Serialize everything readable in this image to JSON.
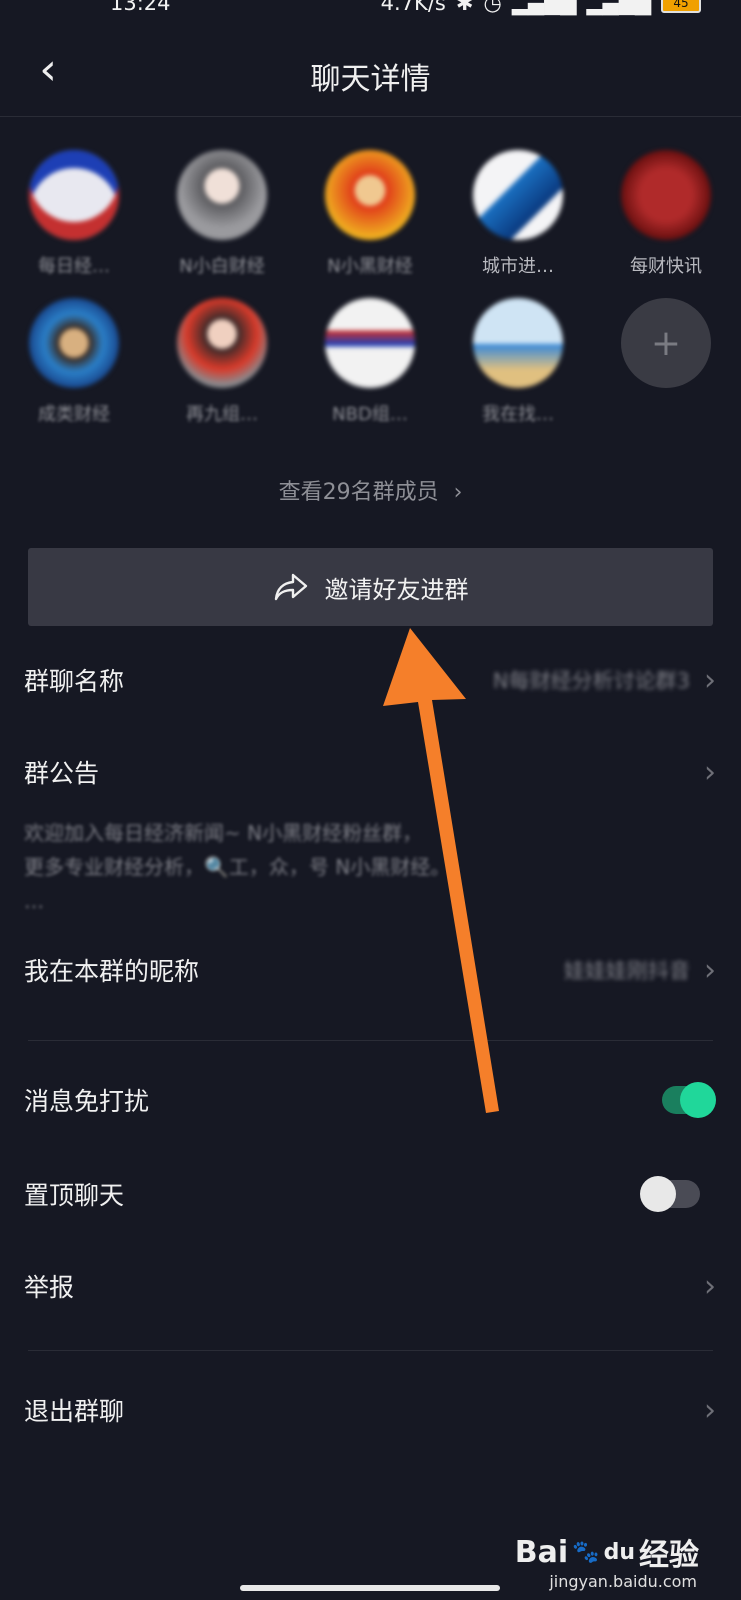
{
  "status": {
    "time": "13:24",
    "speed": "4.7K/s",
    "battery": "45"
  },
  "header": {
    "title": "聊天详情",
    "back_icon": "‹"
  },
  "members": [
    {
      "name": "每日经…",
      "color": "#e8e8f0"
    },
    {
      "name": "N小白财经",
      "color": "#8c8c90"
    },
    {
      "name": "N小黑财经",
      "color": "#e84a1a"
    },
    {
      "name": "城市进…",
      "color": "#f0f0f4"
    },
    {
      "name": "每财快讯",
      "color": "#8a1a1a"
    },
    {
      "name": "成类财经",
      "color": "#2a7fc8"
    },
    {
      "name": "再九组…",
      "color": "#7a7a7e"
    },
    {
      "name": "NBD组…",
      "color": "#f2f2f2"
    },
    {
      "name": "我在找…",
      "color": "#9cc8e8"
    },
    {
      "name": "",
      "add_symbol": "+"
    }
  ],
  "view_members": "查看29名群成员",
  "invite": {
    "label": "邀请好友进群",
    "icon": "share-arrow-icon"
  },
  "group_name": {
    "label": "群聊名称",
    "value": "N每财经分析讨论群3"
  },
  "notice": {
    "label": "群公告",
    "line1": "欢迎加入每日经济新闻~ N小黑财经粉丝群，",
    "line2": "更多专业财经分析，🔍工，众，号 N小黑财经。",
    "line3": "…"
  },
  "nickname": {
    "label": "我在本群的昵称",
    "value": "娃娃娃刚抖音"
  },
  "mute": {
    "label": "消息免打扰",
    "state": "on"
  },
  "pin": {
    "label": "置顶聊天",
    "state": "off"
  },
  "report": {
    "label": "举报"
  },
  "quit": {
    "label": "退出群聊"
  },
  "colors": {
    "bg": "#161823",
    "accent_toggle": "#20d79a",
    "arrow": "#f57f2a"
  },
  "watermark": {
    "brand": "Bai",
    "paw": "du",
    "cn": "经验",
    "url": "jingyan.baidu.com"
  },
  "chevron": "›"
}
